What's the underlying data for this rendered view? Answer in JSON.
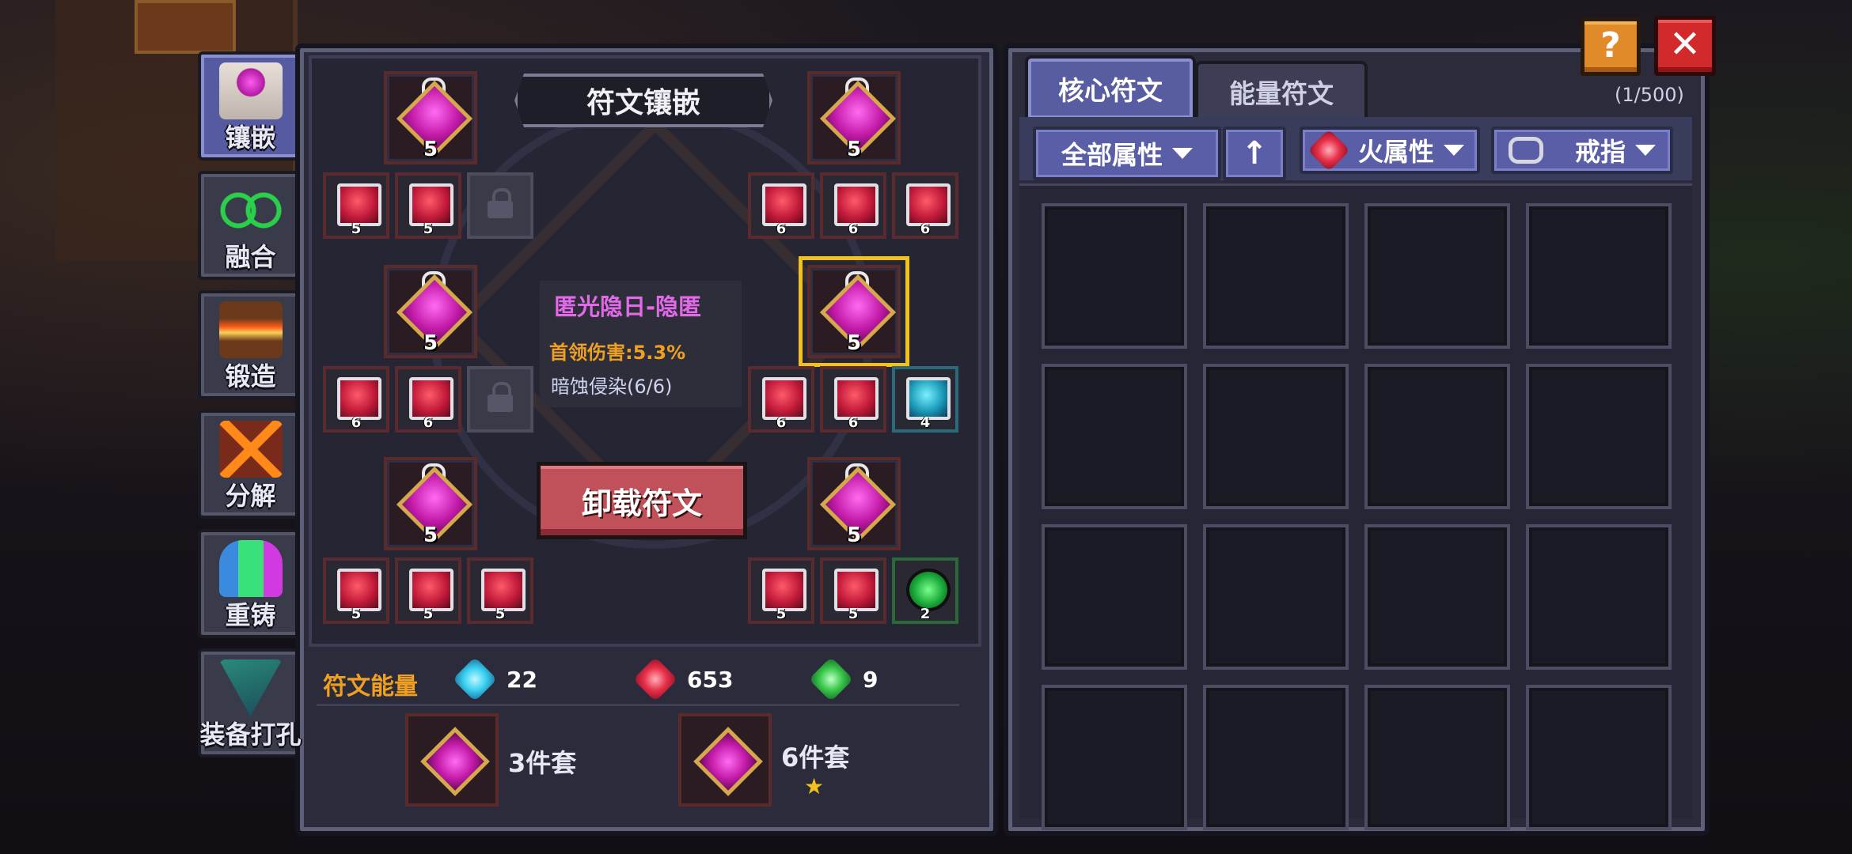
{
  "sidebar": {
    "items": [
      {
        "label": "镶嵌",
        "active": true
      },
      {
        "label": "融合"
      },
      {
        "label": "锻造"
      },
      {
        "label": "分解"
      },
      {
        "label": "重铸"
      },
      {
        "label": "装备打孔"
      }
    ]
  },
  "left_panel": {
    "title": "符文镶嵌",
    "cores": [
      {
        "level": "5",
        "runes": [
          "5",
          "5",
          "lock"
        ]
      },
      {
        "level": "5",
        "runes": [
          "6",
          "6",
          "6"
        ]
      },
      {
        "level": "5",
        "runes": [
          "6",
          "6",
          "lock"
        ]
      },
      {
        "level": "5",
        "runes": [
          "6",
          "6",
          "4"
        ],
        "selected": true
      },
      {
        "level": "5",
        "runes": [
          "5",
          "5",
          "5"
        ]
      },
      {
        "level": "5",
        "runes": [
          "5",
          "5",
          "2"
        ]
      }
    ],
    "tooltip": {
      "name": "匿光隐日-隐匿",
      "stat": "首领伤害:5.3%",
      "set": "暗蚀侵染(6/6)"
    },
    "unload_button": "卸载符文"
  },
  "energy": {
    "label": "符文能量",
    "stats": [
      {
        "icon": "blue-energy-icon",
        "value": "22",
        "color": "#3ad0f0"
      },
      {
        "icon": "red-energy-icon",
        "value": "653",
        "color": "#e8304a"
      },
      {
        "icon": "green-energy-icon",
        "value": "9",
        "color": "#3ac84a"
      }
    ],
    "sets": [
      {
        "label": "3件套",
        "starred": false
      },
      {
        "label": "6件套",
        "starred": true,
        "star": "★"
      }
    ]
  },
  "right_panel": {
    "tabs": [
      {
        "label": "核心符文",
        "active": true
      },
      {
        "label": "能量符文"
      }
    ],
    "count": "(1/500)",
    "filters": {
      "attribute": "全部属性",
      "sort_icon": "↑",
      "element": "火属性",
      "slot": "戒指"
    },
    "grid_cells": 16
  },
  "top_buttons": {
    "help": "?",
    "close": "✕"
  },
  "colors": {
    "accent": "#585ca0",
    "gold": "#f2c21a",
    "unload": "#c0505a"
  }
}
